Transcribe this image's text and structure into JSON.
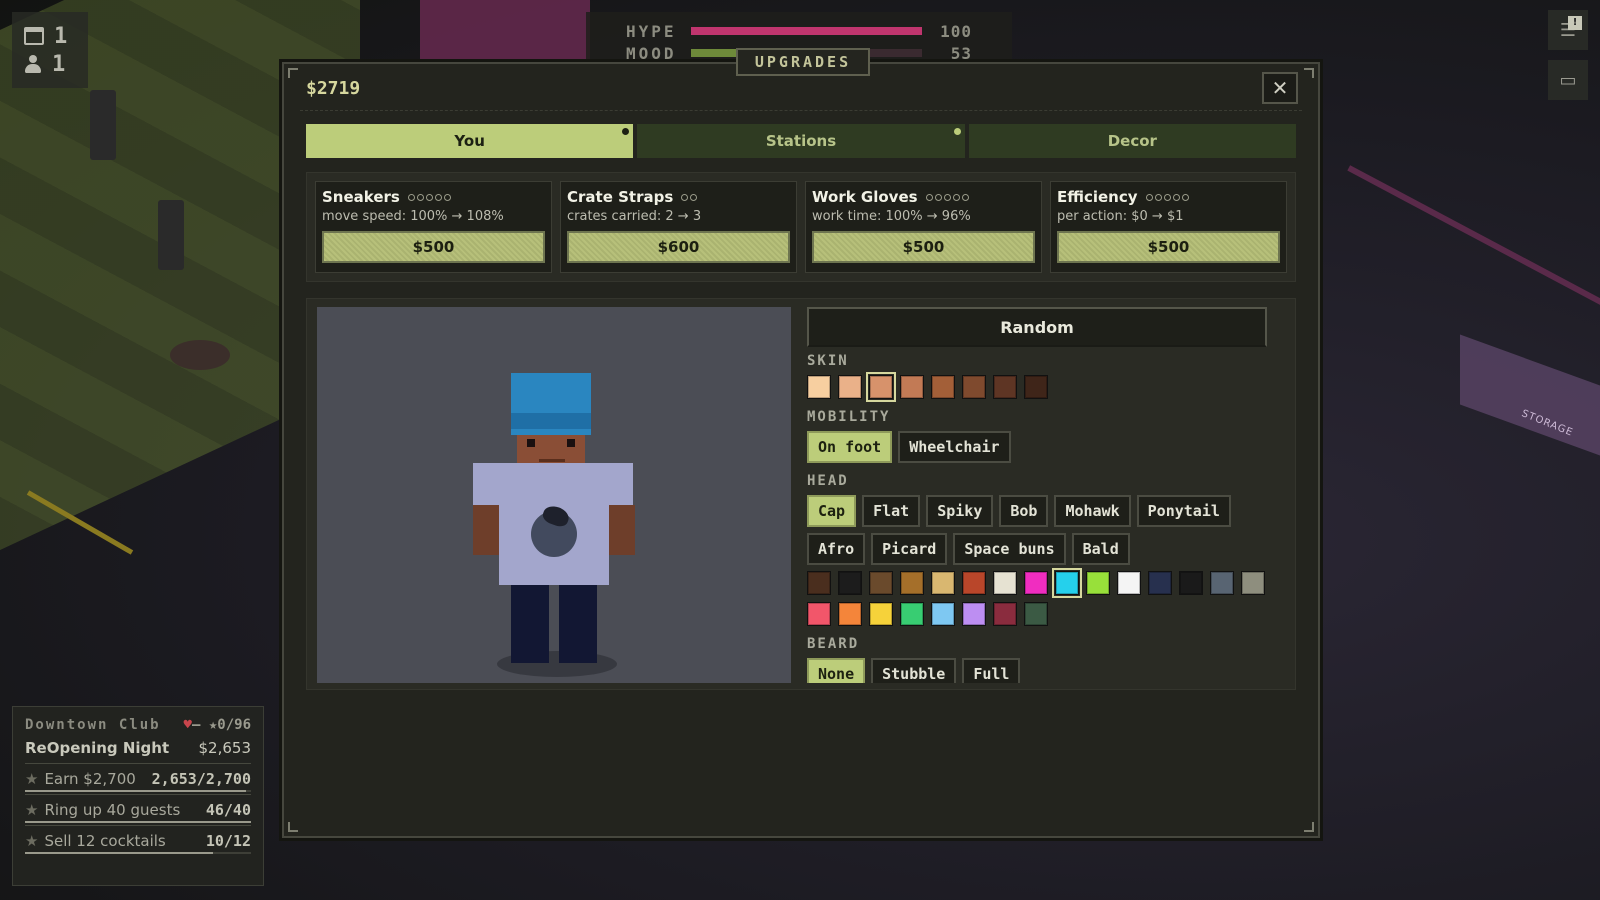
{
  "hud": {
    "day_value": "1",
    "guests_value": "1",
    "hype_label": "HYPE",
    "hype_value": "100",
    "hype_fraction": 1.0,
    "mood_label": "MOOD",
    "mood_value": "53",
    "mood_fraction": 0.53
  },
  "objectives": {
    "venue": "Downtown Club",
    "rating": "0/96",
    "event": "ReOpening Night",
    "event_money": "$2,653",
    "items": [
      {
        "label": "Earn $2,700",
        "progress": "2,653/2,700",
        "fraction": 0.98
      },
      {
        "label": "Ring up 40 guests",
        "progress": "46/40",
        "fraction": 1.0
      },
      {
        "label": "Sell 12 cocktails",
        "progress": "10/12",
        "fraction": 0.83
      }
    ]
  },
  "modal": {
    "title": "UPGRADES",
    "money": "$2719",
    "close_symbol": "✕",
    "tabs": [
      {
        "label": "You",
        "active": true,
        "dot": true
      },
      {
        "label": "Stations",
        "active": false,
        "dot": true
      },
      {
        "label": "Decor",
        "active": false,
        "dot": false
      }
    ],
    "upgrades": [
      {
        "name": "Sneakers",
        "pips": 5,
        "desc": "move speed: 100% → 108%",
        "price": "$500"
      },
      {
        "name": "Crate Straps",
        "pips": 2,
        "desc": "crates carried: 2 → 3",
        "price": "$600"
      },
      {
        "name": "Work Gloves",
        "pips": 5,
        "desc": "work time: 100% → 96%",
        "price": "$500"
      },
      {
        "name": "Efficiency",
        "pips": 5,
        "desc": "per action: $0 → $1",
        "price": "$500"
      }
    ],
    "random_label": "Random",
    "skin_label": "SKIN",
    "skin_colors": [
      "#f7cfa0",
      "#eab189",
      "#d7926b",
      "#c27a55",
      "#a35f38",
      "#7f4a2e",
      "#5e3524",
      "#3f2519"
    ],
    "skin_selected": 2,
    "mobility_label": "MOBILITY",
    "mobility_options": [
      "On foot",
      "Wheelchair"
    ],
    "mobility_selected": 0,
    "head_label": "HEAD",
    "head_options": [
      "Cap",
      "Flat",
      "Spiky",
      "Bob",
      "Mohawk",
      "Ponytail",
      "Afro",
      "Picard",
      "Space buns",
      "Bald"
    ],
    "head_selected": 0,
    "hair_colors": [
      "#4a2e1e",
      "#1c1c1c",
      "#6a4a2c",
      "#a56f2a",
      "#d9b770",
      "#b9462a",
      "#e6e2d2",
      "#f02dc0",
      "#25d0ec",
      "#98e03a",
      "#f4f4f4",
      "#27304e",
      "#1a1a1a",
      "#586472",
      "#8e8e7e",
      "#f2566a",
      "#f4853a",
      "#f6d23a",
      "#38cd72",
      "#7ec8f2",
      "#bd8ef2",
      "#8a2c3e",
      "#3b5a44"
    ],
    "hair_selected": 8,
    "beard_label": "BEARD",
    "beard_options": [
      "None",
      "Stubble",
      "Full"
    ],
    "beard_selected": 0
  }
}
